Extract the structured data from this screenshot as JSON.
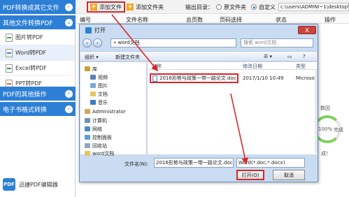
{
  "sidebar": {
    "cat1": "PDF转换成其它文件",
    "cat2": "其他文件转换PDF",
    "items": [
      "图片转PDF",
      "Word转PDF",
      "Excel转PDF",
      "PPT转PDF"
    ],
    "cat3": "PDF的其他操作",
    "cat4": "电子书格式转换",
    "logo": "迅捷PDF编辑器"
  },
  "toolbar": {
    "add_file": "添加文件",
    "add_folder": "添加文件夹",
    "output_label": "输出目录：",
    "radio_original": "原文件夹",
    "radio_custom": "自定义",
    "path": "c:\\users\\ADMINI~1\\desktop\\"
  },
  "columns": [
    "编号",
    "文件名称",
    "总页数",
    "页码选择",
    "状态",
    "操作"
  ],
  "right_fragments": [
    "数因",
    "100%",
    "完成",
    "成！"
  ],
  "dialog": {
    "title": "打开",
    "close": "X",
    "address": "« word文档",
    "search_placeholder": "搜索 word文档",
    "organize": "组织 ▾",
    "new_folder": "新建文件夹",
    "nav_items": [
      "库",
      "视频",
      "图片",
      "文档",
      "音乐",
      "Administrator",
      "计算机",
      "网络",
      "控制面板",
      "回收站",
      "word文档"
    ],
    "headers": [
      "名称",
      "修改日期",
      "类型"
    ],
    "file": {
      "name": "2016形势与政策一带一路论文.doc",
      "date": "2017/1/10 10:49",
      "type": "Microsof"
    },
    "filename_label": "文件名(N):",
    "filename_value": "2016形势与政策一带一路论文.doc",
    "filetype": "Word(*.doc,*.docx)",
    "open": "打开(O)",
    "cancel": "取消"
  },
  "colors": {
    "accent": "#2d7fd6",
    "highlight": "#d9262c"
  }
}
